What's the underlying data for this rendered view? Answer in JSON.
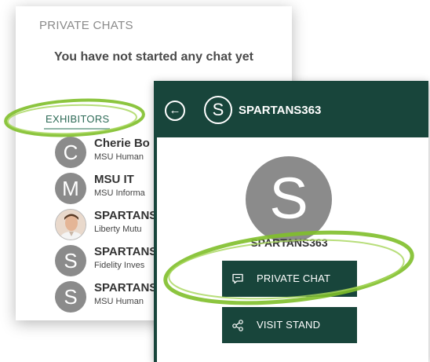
{
  "private_chats": {
    "title": "PRIVATE CHATS",
    "empty_message": "You have not started any chat yet"
  },
  "exhibitors": {
    "label": "EXHIBITORS",
    "items": [
      {
        "avatar": "C",
        "name": "Cherie Bo",
        "org": "MSU Human"
      },
      {
        "avatar": "M",
        "name": "MSU IT",
        "org": "MSU Informa"
      },
      {
        "avatar": "photo",
        "name": "SPARTANS",
        "org": "Liberty Mutu"
      },
      {
        "avatar": "S",
        "name": "SPARTANS",
        "org": "Fidelity Inves"
      },
      {
        "avatar": "S",
        "name": "SPARTANS",
        "org": "MSU Human"
      }
    ]
  },
  "profile": {
    "header_avatar": "S",
    "header_name": "SPARTANS363",
    "avatar_letter": "S",
    "name": "SPARTANS363",
    "private_chat_label": "PRIVATE CHAT",
    "visit_stand_label": "VISIT STAND"
  },
  "colors": {
    "brand_green": "#18453b",
    "avatar_gray": "#8b8b8b",
    "highlight_green": "#7fbf2a"
  }
}
